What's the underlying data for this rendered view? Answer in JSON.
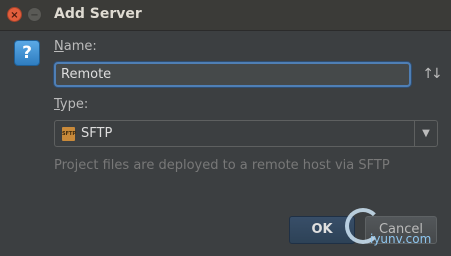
{
  "window": {
    "title": "Add Server",
    "close_glyph": "×",
    "minimize_glyph": "−"
  },
  "help_icon": {
    "icon": "help-icon",
    "glyph": "?"
  },
  "form": {
    "name_label_mnemonic": "N",
    "name_label_rest": "ame:",
    "name_value": "Remote",
    "sort_glyph": "↑↓",
    "type_label_mnemonic": "T",
    "type_label_rest": "ype:",
    "type_value": "SFTP",
    "type_icon_text": "SFTP",
    "dropdown_glyph": "▼",
    "description": "Project files are deployed to a remote host via SFTP"
  },
  "buttons": {
    "ok": "OK",
    "cancel": "Cancel"
  },
  "watermark": {
    "text": "iyunv.com"
  },
  "colors": {
    "accent_focus": "#4f7fb5",
    "background": "#3c3f41",
    "close_button": "#e25e3c"
  }
}
